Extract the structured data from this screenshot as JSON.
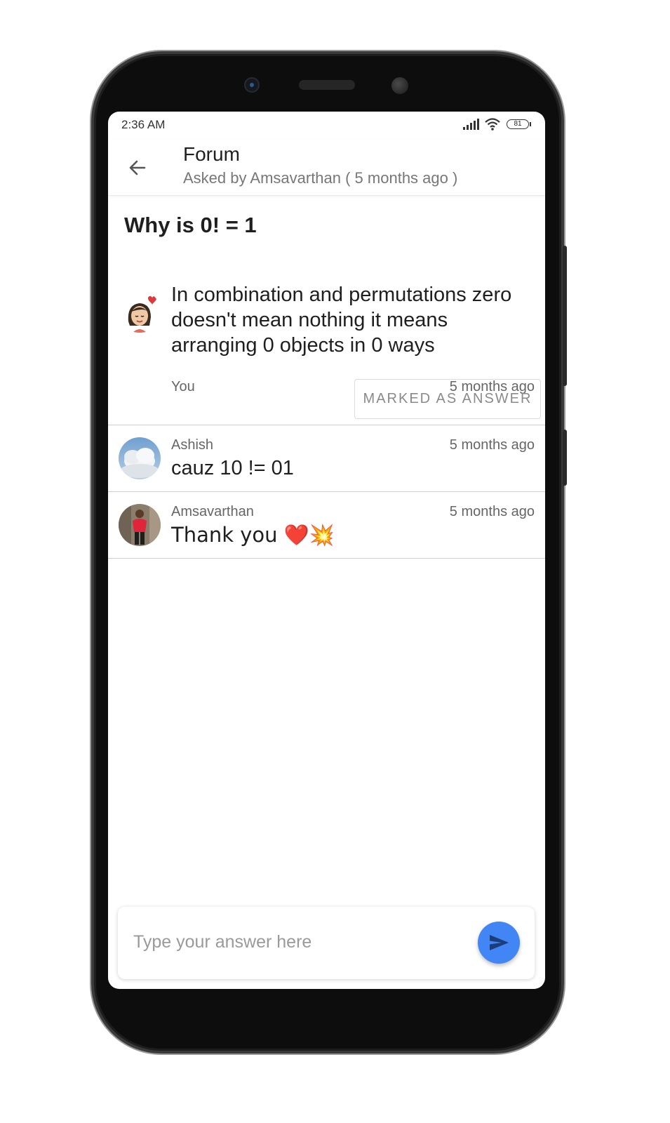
{
  "status_bar": {
    "time": "2:36 AM",
    "battery": "81"
  },
  "app_bar": {
    "title": "Forum",
    "subtitle": "Asked by Amsavarthan ( 5 months ago )"
  },
  "question": {
    "title": "Why is 0! = 1"
  },
  "answers": [
    {
      "author": "You",
      "time": "5 months ago",
      "text": "In combination and permutations zero doesn't mean nothing it means arranging 0 objects in 0 ways",
      "badge": "MARKED AS ANSWER",
      "avatar": "bitmoji-avatar"
    },
    {
      "author": "Ashish",
      "time": "5 months ago",
      "text": "cauz 10 != 01",
      "avatar": "clouds-avatar"
    },
    {
      "author": "Amsavarthan",
      "time": "5 months ago",
      "text": "Thank you ❤️💥",
      "avatar": "person-photo-avatar"
    }
  ],
  "composer": {
    "placeholder": "Type your answer here"
  },
  "colors": {
    "accent": "#4285f4",
    "heart": "#d93a3a"
  }
}
